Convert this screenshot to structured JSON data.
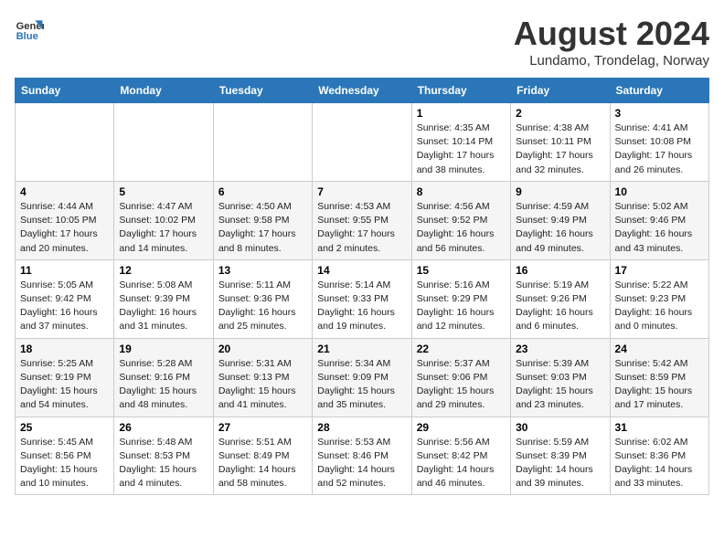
{
  "header": {
    "logo_line1": "General",
    "logo_line2": "Blue",
    "month_year": "August 2024",
    "location": "Lundamo, Trondelag, Norway"
  },
  "weekdays": [
    "Sunday",
    "Monday",
    "Tuesday",
    "Wednesday",
    "Thursday",
    "Friday",
    "Saturday"
  ],
  "weeks": [
    [
      {
        "day": "",
        "info": ""
      },
      {
        "day": "",
        "info": ""
      },
      {
        "day": "",
        "info": ""
      },
      {
        "day": "",
        "info": ""
      },
      {
        "day": "1",
        "info": "Sunrise: 4:35 AM\nSunset: 10:14 PM\nDaylight: 17 hours\nand 38 minutes."
      },
      {
        "day": "2",
        "info": "Sunrise: 4:38 AM\nSunset: 10:11 PM\nDaylight: 17 hours\nand 32 minutes."
      },
      {
        "day": "3",
        "info": "Sunrise: 4:41 AM\nSunset: 10:08 PM\nDaylight: 17 hours\nand 26 minutes."
      }
    ],
    [
      {
        "day": "4",
        "info": "Sunrise: 4:44 AM\nSunset: 10:05 PM\nDaylight: 17 hours\nand 20 minutes."
      },
      {
        "day": "5",
        "info": "Sunrise: 4:47 AM\nSunset: 10:02 PM\nDaylight: 17 hours\nand 14 minutes."
      },
      {
        "day": "6",
        "info": "Sunrise: 4:50 AM\nSunset: 9:58 PM\nDaylight: 17 hours\nand 8 minutes."
      },
      {
        "day": "7",
        "info": "Sunrise: 4:53 AM\nSunset: 9:55 PM\nDaylight: 17 hours\nand 2 minutes."
      },
      {
        "day": "8",
        "info": "Sunrise: 4:56 AM\nSunset: 9:52 PM\nDaylight: 16 hours\nand 56 minutes."
      },
      {
        "day": "9",
        "info": "Sunrise: 4:59 AM\nSunset: 9:49 PM\nDaylight: 16 hours\nand 49 minutes."
      },
      {
        "day": "10",
        "info": "Sunrise: 5:02 AM\nSunset: 9:46 PM\nDaylight: 16 hours\nand 43 minutes."
      }
    ],
    [
      {
        "day": "11",
        "info": "Sunrise: 5:05 AM\nSunset: 9:42 PM\nDaylight: 16 hours\nand 37 minutes."
      },
      {
        "day": "12",
        "info": "Sunrise: 5:08 AM\nSunset: 9:39 PM\nDaylight: 16 hours\nand 31 minutes."
      },
      {
        "day": "13",
        "info": "Sunrise: 5:11 AM\nSunset: 9:36 PM\nDaylight: 16 hours\nand 25 minutes."
      },
      {
        "day": "14",
        "info": "Sunrise: 5:14 AM\nSunset: 9:33 PM\nDaylight: 16 hours\nand 19 minutes."
      },
      {
        "day": "15",
        "info": "Sunrise: 5:16 AM\nSunset: 9:29 PM\nDaylight: 16 hours\nand 12 minutes."
      },
      {
        "day": "16",
        "info": "Sunrise: 5:19 AM\nSunset: 9:26 PM\nDaylight: 16 hours\nand 6 minutes."
      },
      {
        "day": "17",
        "info": "Sunrise: 5:22 AM\nSunset: 9:23 PM\nDaylight: 16 hours\nand 0 minutes."
      }
    ],
    [
      {
        "day": "18",
        "info": "Sunrise: 5:25 AM\nSunset: 9:19 PM\nDaylight: 15 hours\nand 54 minutes."
      },
      {
        "day": "19",
        "info": "Sunrise: 5:28 AM\nSunset: 9:16 PM\nDaylight: 15 hours\nand 48 minutes."
      },
      {
        "day": "20",
        "info": "Sunrise: 5:31 AM\nSunset: 9:13 PM\nDaylight: 15 hours\nand 41 minutes."
      },
      {
        "day": "21",
        "info": "Sunrise: 5:34 AM\nSunset: 9:09 PM\nDaylight: 15 hours\nand 35 minutes."
      },
      {
        "day": "22",
        "info": "Sunrise: 5:37 AM\nSunset: 9:06 PM\nDaylight: 15 hours\nand 29 minutes."
      },
      {
        "day": "23",
        "info": "Sunrise: 5:39 AM\nSunset: 9:03 PM\nDaylight: 15 hours\nand 23 minutes."
      },
      {
        "day": "24",
        "info": "Sunrise: 5:42 AM\nSunset: 8:59 PM\nDaylight: 15 hours\nand 17 minutes."
      }
    ],
    [
      {
        "day": "25",
        "info": "Sunrise: 5:45 AM\nSunset: 8:56 PM\nDaylight: 15 hours\nand 10 minutes."
      },
      {
        "day": "26",
        "info": "Sunrise: 5:48 AM\nSunset: 8:53 PM\nDaylight: 15 hours\nand 4 minutes."
      },
      {
        "day": "27",
        "info": "Sunrise: 5:51 AM\nSunset: 8:49 PM\nDaylight: 14 hours\nand 58 minutes."
      },
      {
        "day": "28",
        "info": "Sunrise: 5:53 AM\nSunset: 8:46 PM\nDaylight: 14 hours\nand 52 minutes."
      },
      {
        "day": "29",
        "info": "Sunrise: 5:56 AM\nSunset: 8:42 PM\nDaylight: 14 hours\nand 46 minutes."
      },
      {
        "day": "30",
        "info": "Sunrise: 5:59 AM\nSunset: 8:39 PM\nDaylight: 14 hours\nand 39 minutes."
      },
      {
        "day": "31",
        "info": "Sunrise: 6:02 AM\nSunset: 8:36 PM\nDaylight: 14 hours\nand 33 minutes."
      }
    ]
  ]
}
